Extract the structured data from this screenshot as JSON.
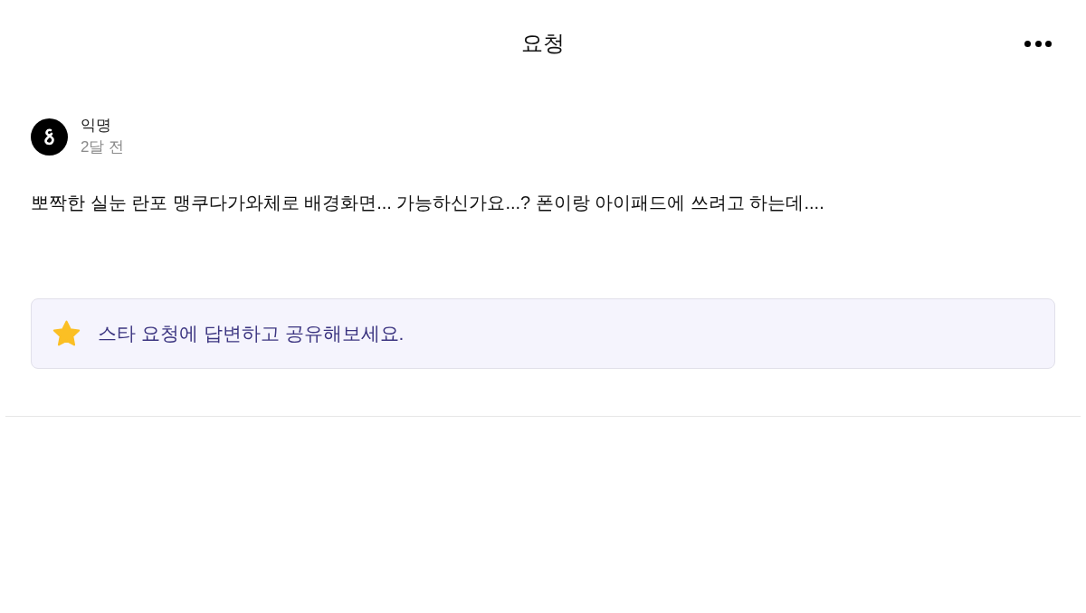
{
  "header": {
    "title": "요청"
  },
  "post": {
    "author": "익명",
    "time": "2달 전",
    "body": "뽀짝한 실눈 란포 맹쿠다가와체로 배경화면... 가능하신가요...? 폰이랑 아이패드에 쓰려고 하는데...."
  },
  "notice": {
    "text": "스타 요청에 답변하고 공유해보세요."
  }
}
